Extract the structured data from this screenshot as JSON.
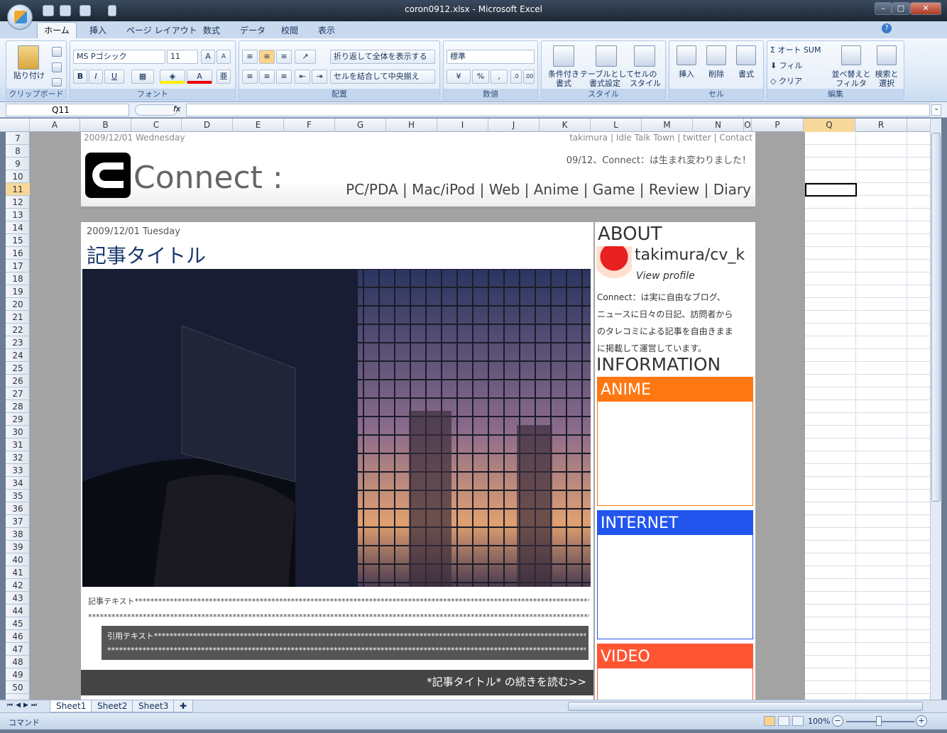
{
  "window": {
    "title": "coron0912.xlsx - Microsoft Excel"
  },
  "ribbon": {
    "tabs": [
      "ホーム",
      "挿入",
      "ページ レイアウト",
      "数式",
      "データ",
      "校閲",
      "表示"
    ],
    "clipboard": {
      "paste": "貼り付け",
      "label": "クリップボード"
    },
    "font": {
      "name": "MS Pゴシック",
      "size": "11",
      "bold": "B",
      "italic": "I",
      "underline": "U",
      "label": "フォント"
    },
    "alignment": {
      "wrap": "折り返して全体を表示する",
      "merge": "セルを結合して中央揃え",
      "label": "配置"
    },
    "number": {
      "format": "標準",
      "percent": "%",
      "comma": ",",
      "label": "数値"
    },
    "styles": {
      "conditional": "条件付き\n書式",
      "table": "テーブルとして\n書式設定",
      "cell": "セルの\nスタイル",
      "label": "スタイル"
    },
    "cells": {
      "insert": "挿入",
      "delete": "削除",
      "format": "書式",
      "label": "セル"
    },
    "editing": {
      "autosum": "オート SUM",
      "fill": "フィル",
      "clear": "クリア",
      "sort": "並べ替えと\nフィルタ",
      "find": "検索と\n選択",
      "label": "編集"
    }
  },
  "formula_bar": {
    "name_box": "Q11",
    "fx": "fx",
    "value": ""
  },
  "columns": [
    "A",
    "B",
    "C",
    "D",
    "E",
    "F",
    "G",
    "H",
    "I",
    "J",
    "K",
    "L",
    "M",
    "N",
    "O",
    "P",
    "Q",
    "R"
  ],
  "rows": [
    "7",
    "8",
    "9",
    "10",
    "11",
    "12",
    "13",
    "14",
    "15",
    "16",
    "17",
    "18",
    "19",
    "20",
    "21",
    "22",
    "23",
    "24",
    "25",
    "26",
    "27",
    "28",
    "29",
    "30",
    "31",
    "32",
    "33",
    "34",
    "35",
    "36",
    "37",
    "38",
    "39",
    "40",
    "41",
    "42",
    "43",
    "44",
    "45",
    "46",
    "47",
    "48",
    "49",
    "50"
  ],
  "blog": {
    "top_date": "2009/12/01 Wednesday",
    "top_links": [
      "takimura",
      "Idle Talk Town",
      "twitter",
      "Contact"
    ],
    "logo_text": "Connect :",
    "announcement": "09/12、Connect：は生まれ変わりました！",
    "nav": [
      "PC/PDA",
      "Mac/iPod",
      "Web",
      "Anime",
      "Game",
      "Review",
      "Diary"
    ],
    "post": {
      "date": "2009/12/01 Tuesday",
      "title": "記事タイトル",
      "body_line1": "記事テキスト**********************************************************************************************************************",
      "body_line2": "****************************************************************************************************************************************",
      "quote_line1": "引用テキスト*********************************************************************************************************************",
      "quote_line2": "****************************************************************************************************************************************",
      "read_more": "*記事タイトル* の続きを読む>>"
    },
    "sidebar": {
      "about_title": "ABOUT",
      "username": "takimura/cv_k",
      "view_profile": "View profile",
      "description": [
        "Connect：は実に自由なブログ、",
        "ニュースに日々の日記、訪問者から",
        "のタレコミによる記事を自由きまま",
        "に掲載して運営しています。"
      ],
      "info_title": "INFORMATION",
      "boxes": [
        {
          "title": "ANIME",
          "color": "#ff7711"
        },
        {
          "title": "INTERNET",
          "color": "#2255ee"
        },
        {
          "title": "VIDEO",
          "color": "#ff5533"
        }
      ]
    }
  },
  "sheets": [
    "Sheet1",
    "Sheet2",
    "Sheet3"
  ],
  "status": {
    "mode": "コマンド",
    "zoom": "100%"
  }
}
